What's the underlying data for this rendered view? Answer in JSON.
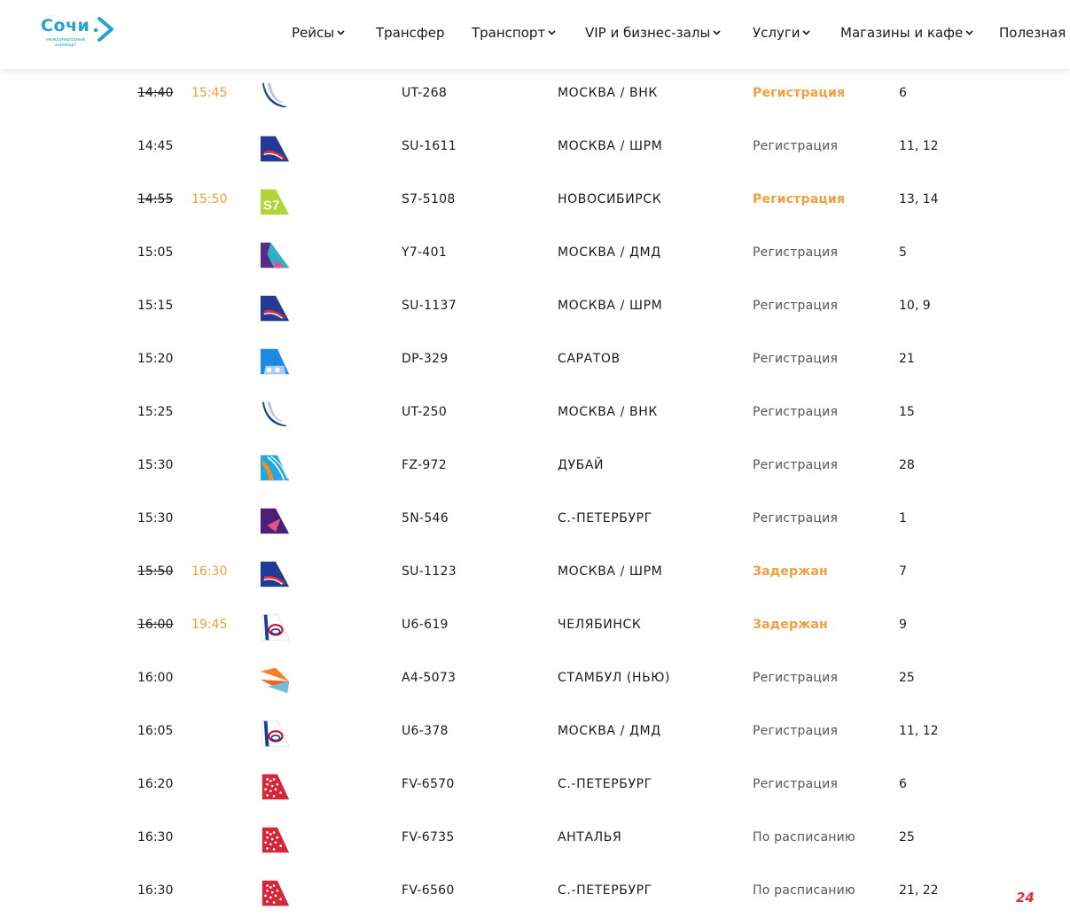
{
  "header": {
    "logo": {
      "name": "Сочи",
      "subtitle_line1": "международный",
      "subtitle_line2": "аэропорт"
    },
    "nav": [
      {
        "label": "Рейсы",
        "has_dropdown": true
      },
      {
        "label": "Трансфер",
        "has_dropdown": false
      },
      {
        "label": "Транспорт",
        "has_dropdown": true
      },
      {
        "label": "VIP и бизнес-залы",
        "has_dropdown": true
      },
      {
        "label": "Услуги",
        "has_dropdown": true
      },
      {
        "label": "Магазины и кафе",
        "has_dropdown": true
      },
      {
        "label": "Полезная и",
        "has_dropdown": false
      }
    ]
  },
  "colors": {
    "brand": "#2a9fd6",
    "alert": "#f0a03c",
    "muted": "#555555"
  },
  "flights": [
    {
      "time": "14:40",
      "new_time": "15:45",
      "logo": "utair-logo",
      "flight": "UT-268",
      "city": "МОСКВА / ВНК",
      "status": "Регистрация",
      "alert": true,
      "gate": "6"
    },
    {
      "time": "14:45",
      "new_time": "",
      "logo": "aeroflot-logo",
      "flight": "SU-1611",
      "city": "МОСКВА / ШРМ",
      "status": "Регистрация",
      "alert": false,
      "gate": "11, 12"
    },
    {
      "time": "14:55",
      "new_time": "15:50",
      "logo": "s7-logo",
      "flight": "S7-5108",
      "city": "НОВОСИБИРСК",
      "status": "Регистрация",
      "alert": true,
      "gate": "13, 14"
    },
    {
      "time": "15:05",
      "new_time": "",
      "logo": "northwind-logo",
      "flight": "Y7-401",
      "city": "МОСКВА / ДМД",
      "status": "Регистрация",
      "alert": false,
      "gate": "5"
    },
    {
      "time": "15:15",
      "new_time": "",
      "logo": "aeroflot-logo",
      "flight": "SU-1137",
      "city": "МОСКВА / ШРМ",
      "status": "Регистрация",
      "alert": false,
      "gate": "10, 9"
    },
    {
      "time": "15:20",
      "new_time": "",
      "logo": "pobeda-logo",
      "flight": "DP-329",
      "city": "САРАТОВ",
      "status": "Регистрация",
      "alert": false,
      "gate": "21"
    },
    {
      "time": "15:25",
      "new_time": "",
      "logo": "utair-logo",
      "flight": "UT-250",
      "city": "МОСКВА / ВНК",
      "status": "Регистрация",
      "alert": false,
      "gate": "15"
    },
    {
      "time": "15:30",
      "new_time": "",
      "logo": "flydubai-logo",
      "flight": "FZ-972",
      "city": "ДУБАЙ",
      "status": "Регистрация",
      "alert": false,
      "gate": "28"
    },
    {
      "time": "15:30",
      "new_time": "",
      "logo": "smartavia-logo",
      "flight": "5N-546",
      "city": "С.-ПЕТЕРБУРГ",
      "status": "Регистрация",
      "alert": false,
      "gate": "1"
    },
    {
      "time": "15:50",
      "new_time": "16:30",
      "logo": "aeroflot-logo",
      "flight": "SU-1123",
      "city": "МОСКВА / ШРМ",
      "status": "Задержан",
      "alert": true,
      "gate": "7"
    },
    {
      "time": "16:00",
      "new_time": "19:45",
      "logo": "uralairlines-logo",
      "flight": "U6-619",
      "city": "ЧЕЛЯБИНСК",
      "status": "Задержан",
      "alert": true,
      "gate": "9"
    },
    {
      "time": "16:00",
      "new_time": "",
      "logo": "pegasus-logo",
      "flight": "A4-5073",
      "city": "СТАМБУЛ (НЬЮ)",
      "status": "Регистрация",
      "alert": false,
      "gate": "25"
    },
    {
      "time": "16:05",
      "new_time": "",
      "logo": "uralairlines-logo",
      "flight": "U6-378",
      "city": "МОСКВА / ДМД",
      "status": "Регистрация",
      "alert": false,
      "gate": "11, 12"
    },
    {
      "time": "16:20",
      "new_time": "",
      "logo": "rossiya-logo",
      "flight": "FV-6570",
      "city": "С.-ПЕТЕРБУРГ",
      "status": "Регистрация",
      "alert": false,
      "gate": "6"
    },
    {
      "time": "16:30",
      "new_time": "",
      "logo": "rossiya-logo",
      "flight": "FV-6735",
      "city": "АНТАЛЬЯ",
      "status": "По расписанию",
      "alert": false,
      "gate": "25"
    },
    {
      "time": "16:30",
      "new_time": "",
      "logo": "rossiya-logo",
      "flight": "FV-6560",
      "city": "С.-ПЕТЕРБУРГ",
      "status": "По расписанию",
      "alert": false,
      "gate": "21, 22"
    }
  ],
  "watermark": "24"
}
